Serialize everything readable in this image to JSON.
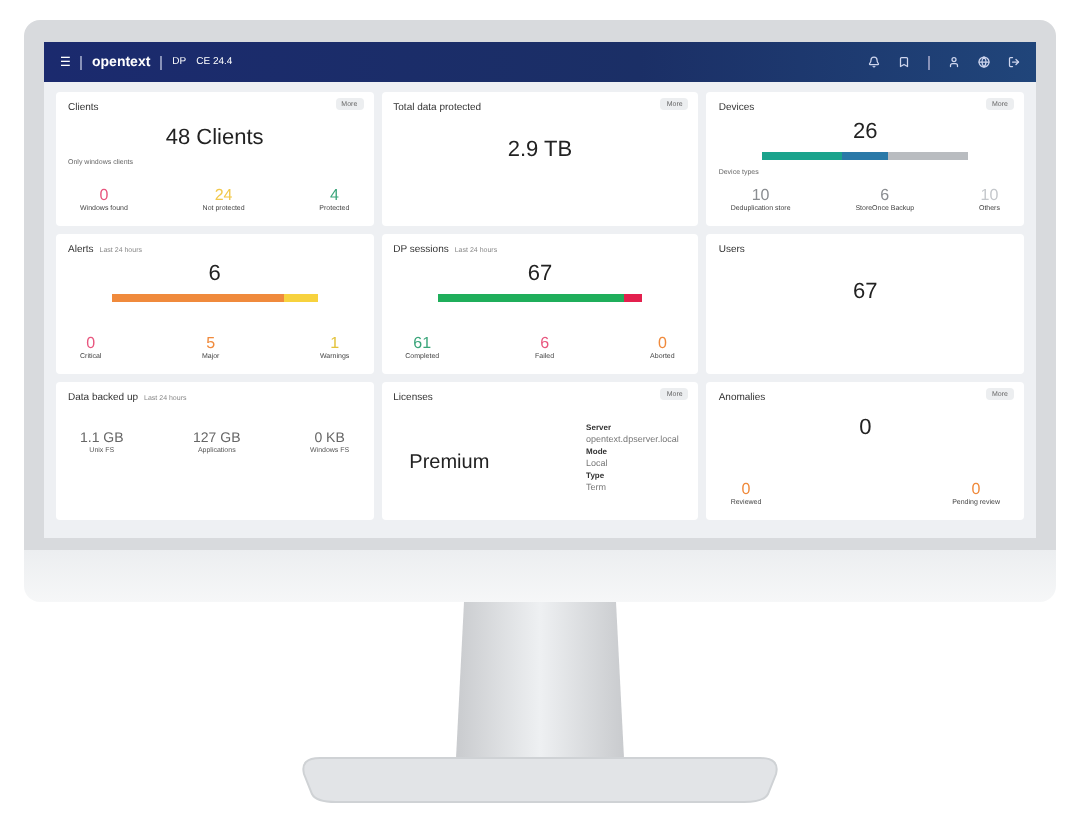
{
  "header": {
    "menu": "☰",
    "brand": "opentext",
    "product": "DP",
    "version": "CE 24.4"
  },
  "cards": [
    {
      "kind": "summary",
      "title": "Clients",
      "more": "More",
      "value": "48 Clients",
      "note": "Only windows clients",
      "stats": [
        {
          "value": "0",
          "label": "Windows found",
          "color": "#e8577f"
        },
        {
          "value": "24",
          "label": "Not protected",
          "color": "#f2c84b"
        },
        {
          "value": "4",
          "label": "Protected",
          "color": "#3aa57a"
        }
      ]
    },
    {
      "kind": "summary",
      "title": "Total data protected",
      "more": "More",
      "value": "2.9 TB"
    },
    {
      "kind": "summary",
      "title": "Devices",
      "more": "More",
      "value": "26",
      "bar": [
        {
          "color": "#1aa38c"
        },
        {
          "color": "#2a79a8"
        },
        {
          "color": "#b9bcc0"
        }
      ],
      "note": "Device types",
      "stats": [
        {
          "value": "10",
          "label": "Deduplication store",
          "color": "#8a8d91"
        },
        {
          "value": "6",
          "label": "StoreOnce Backup",
          "color": "#8a8d91"
        },
        {
          "value": "10",
          "label": "Others",
          "color": "#c5c8cc"
        }
      ]
    },
    {
      "kind": "summary",
      "title": "Alerts",
      "subtitle": "Last 24 hours",
      "value": "6",
      "bar": [
        {
          "color": "#f08a3c"
        },
        {
          "color": "#f7d23e"
        }
      ],
      "stats": [
        {
          "value": "0",
          "label": "Critical",
          "color": "#e8577f"
        },
        {
          "value": "5",
          "label": "Major",
          "color": "#f08a3c"
        },
        {
          "value": "1",
          "label": "Warnings",
          "color": "#e3c23a"
        }
      ]
    },
    {
      "kind": "summary",
      "title": "DP sessions",
      "subtitle": "Last 24 hours",
      "value": "67",
      "bar": [
        {
          "color": "#1fae5b"
        },
        {
          "color": "#e3204e"
        }
      ],
      "stats": [
        {
          "value": "61",
          "label": "Completed",
          "color": "#3aa57a"
        },
        {
          "value": "6",
          "label": "Failed",
          "color": "#e8577f"
        },
        {
          "value": "0",
          "label": "Aborted",
          "color": "#f08a3c"
        }
      ]
    },
    {
      "kind": "summary",
      "title": "Users",
      "value": "67"
    },
    {
      "kind": "volumes",
      "title": "Data backed up",
      "subtitle": "Last 24 hours",
      "stats": [
        {
          "value": "1.1 GB",
          "label": "Unix FS"
        },
        {
          "value": "127 GB",
          "label": "Applications"
        },
        {
          "value": "0 KB",
          "label": "Windows FS"
        }
      ]
    },
    {
      "kind": "licenses",
      "title": "Licenses",
      "more": "More",
      "value": "Premium",
      "details": [
        {
          "label": "Server",
          "value": "opentext.dpserver.local"
        },
        {
          "label": "Mode",
          "value": "Local"
        },
        {
          "label": "Type",
          "value": "Term"
        }
      ]
    },
    {
      "kind": "summary",
      "title": "Anomalies",
      "more": "More",
      "value": "0",
      "stats": [
        {
          "value": "0",
          "label": "Reviewed",
          "color": "#f08a3c"
        },
        {
          "value": "0",
          "label": "Pending review",
          "color": "#f08a3c"
        }
      ]
    }
  ]
}
